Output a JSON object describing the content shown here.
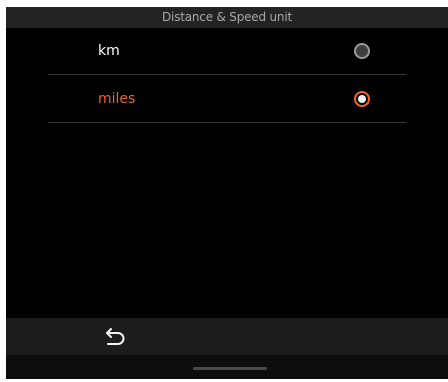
{
  "header": {
    "title": "Distance & Speed unit"
  },
  "options": [
    {
      "label": "km",
      "selected": false,
      "color": "#ffffff"
    },
    {
      "label": "miles",
      "selected": true,
      "color": "#e8642c"
    }
  ],
  "bottom_bar": {
    "back_icon": "back-arrow-icon"
  },
  "colors": {
    "accent": "#f26522",
    "background": "#000000",
    "header_bg": "#232323"
  }
}
